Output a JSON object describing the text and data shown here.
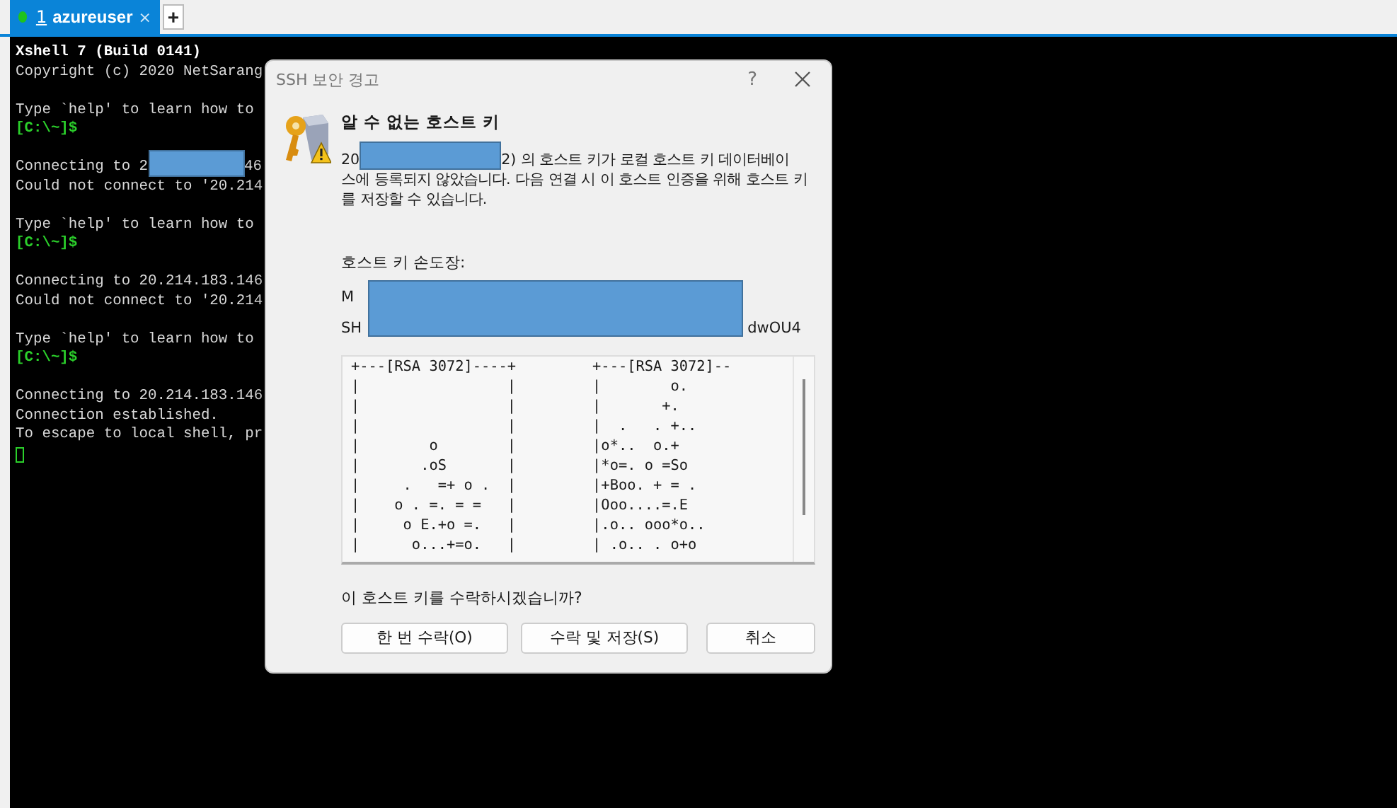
{
  "tabs": [
    {
      "number": "1",
      "label": "azureuser",
      "selected": true,
      "connected": true,
      "close": "×"
    }
  ],
  "new_tab": "+",
  "terminal": {
    "lines": [
      {
        "kind": "bold",
        "text": "Xshell 7 (Build 0141)"
      },
      {
        "kind": "plain",
        "text": "Copyright (c) 2020 NetSarang"
      },
      {
        "kind": "blank"
      },
      {
        "kind": "plain",
        "text": "Type `help' to learn how to"
      },
      {
        "kind": "prompt",
        "text": "[C:\\~]$"
      },
      {
        "kind": "blank"
      },
      {
        "kind": "redacted",
        "text": "Connecting to 2",
        "tail": "46"
      },
      {
        "kind": "plain",
        "text": "Could not connect to '20.214"
      },
      {
        "kind": "blank"
      },
      {
        "kind": "plain",
        "text": "Type `help' to learn how to"
      },
      {
        "kind": "prompt",
        "text": "[C:\\~]$"
      },
      {
        "kind": "blank"
      },
      {
        "kind": "plain",
        "text": "Connecting to 20.214.183.146"
      },
      {
        "kind": "plain",
        "text": "Could not connect to '20.214"
      },
      {
        "kind": "blank"
      },
      {
        "kind": "plain",
        "text": "Type `help' to learn how to"
      },
      {
        "kind": "prompt",
        "text": "[C:\\~]$"
      },
      {
        "kind": "blank"
      },
      {
        "kind": "plain",
        "text": "Connecting to 20.214.183.146"
      },
      {
        "kind": "plain",
        "text": "Connection established."
      },
      {
        "kind": "plain",
        "text": "To escape to local shell, pr"
      },
      {
        "kind": "cursor"
      }
    ]
  },
  "dialog": {
    "title": "SSH 보안 경고",
    "help": "?",
    "heading": "알 수 없는 호스트 키",
    "message_start": "20",
    "message": "2) 의 호스트 키가 로컬 호스트 키 데이터베이",
    "message_rest": "스에 등록되지 않았습니다. 다음 연결 시 이 호스트 인증을 위해 호스트 키를 저장할 수 있습니다.",
    "fingerprint_label": "호스트 키 손도장:",
    "fingerprint_lines": [
      {
        "start": "M"
      },
      {
        "start": "SH",
        "end": "dwOU4"
      }
    ],
    "art_left": [
      "+---[RSA 3072]----+",
      "|                 |",
      "|                 |",
      "|                 |",
      "|        o        |",
      "|       .oS       |",
      "|     .   =+ o .  |",
      "|    o . =. = =   |",
      "|     o E.+o =.   |",
      "|      o...+=o.   |"
    ],
    "art_right": [
      "+---[RSA 3072]--",
      "|        o.",
      "|       +.",
      "|  .   . +..",
      "|o*..  o.+",
      "|*o=. o =So",
      "|+Boo. + = .",
      "|Ooo....=.E",
      "|.o.. ooo*o..",
      "| .o.. . o+o"
    ],
    "question": "이 호스트 키를 수락하시겠습니까?",
    "buttons": [
      "한 번 수락(O)",
      "수락 및 저장(S)",
      "취소"
    ]
  }
}
